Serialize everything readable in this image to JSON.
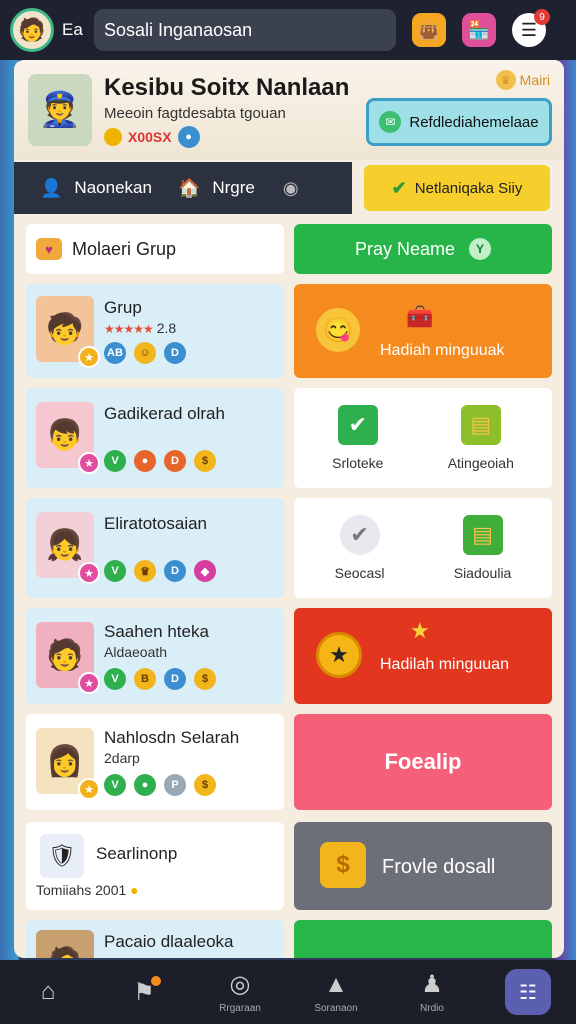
{
  "topbar": {
    "user_label": "Ea",
    "search_text": "Sosali Inganaosan",
    "notification_count": "9"
  },
  "profile": {
    "name": "Kesibu Soitx Nanlaan",
    "subtitle": "Meeoin fagtdesabta tgouan",
    "coins": "X00SX",
    "more_label": "Mairi",
    "action_label": "Refdlediahemelaae"
  },
  "tabs": {
    "tab1": "Naonekan",
    "tab2": "Nrgre",
    "yellow_label": "Netlaniqaka Siiy"
  },
  "group_header": {
    "label": "Molaeri Grup",
    "pray_label": "Pray Neame"
  },
  "left_cards": [
    {
      "title": "Grup",
      "rating": "2.8",
      "stars": "★★★★★"
    },
    {
      "title": "Gadikerad olrah"
    },
    {
      "title": "Eliratotosaian"
    },
    {
      "title": "Saahen hteka",
      "subtitle": "Aldaeoath"
    },
    {
      "title": "Nahlosdn Selarah",
      "subtitle": "2darp"
    },
    {
      "title": "Searlinonp",
      "subtitle": "Tomiiahs 2001"
    },
    {
      "title": "Pacaio dlaaleoka"
    }
  ],
  "right_cards": {
    "orange_label": "Hadiah minguuak",
    "box1_left": "Srloteke",
    "box1_right": "Atingeoiah",
    "box2_left": "Seocasl",
    "box2_right": "Siadoulia",
    "red_label": "Hadilah minguuan",
    "pink_label": "Foealip",
    "grey_label": "Frovle dosall"
  },
  "bottom_nav": [
    {
      "label": ""
    },
    {
      "label": ""
    },
    {
      "label": "Rrgaraan"
    },
    {
      "label": "Soranaon"
    },
    {
      "label": "Nrdio"
    },
    {
      "label": ""
    }
  ],
  "colors": {
    "accent_green": "#27b54a",
    "accent_orange": "#f58b1f",
    "accent_red": "#e2361f",
    "accent_yellow": "#f7cf2d"
  }
}
